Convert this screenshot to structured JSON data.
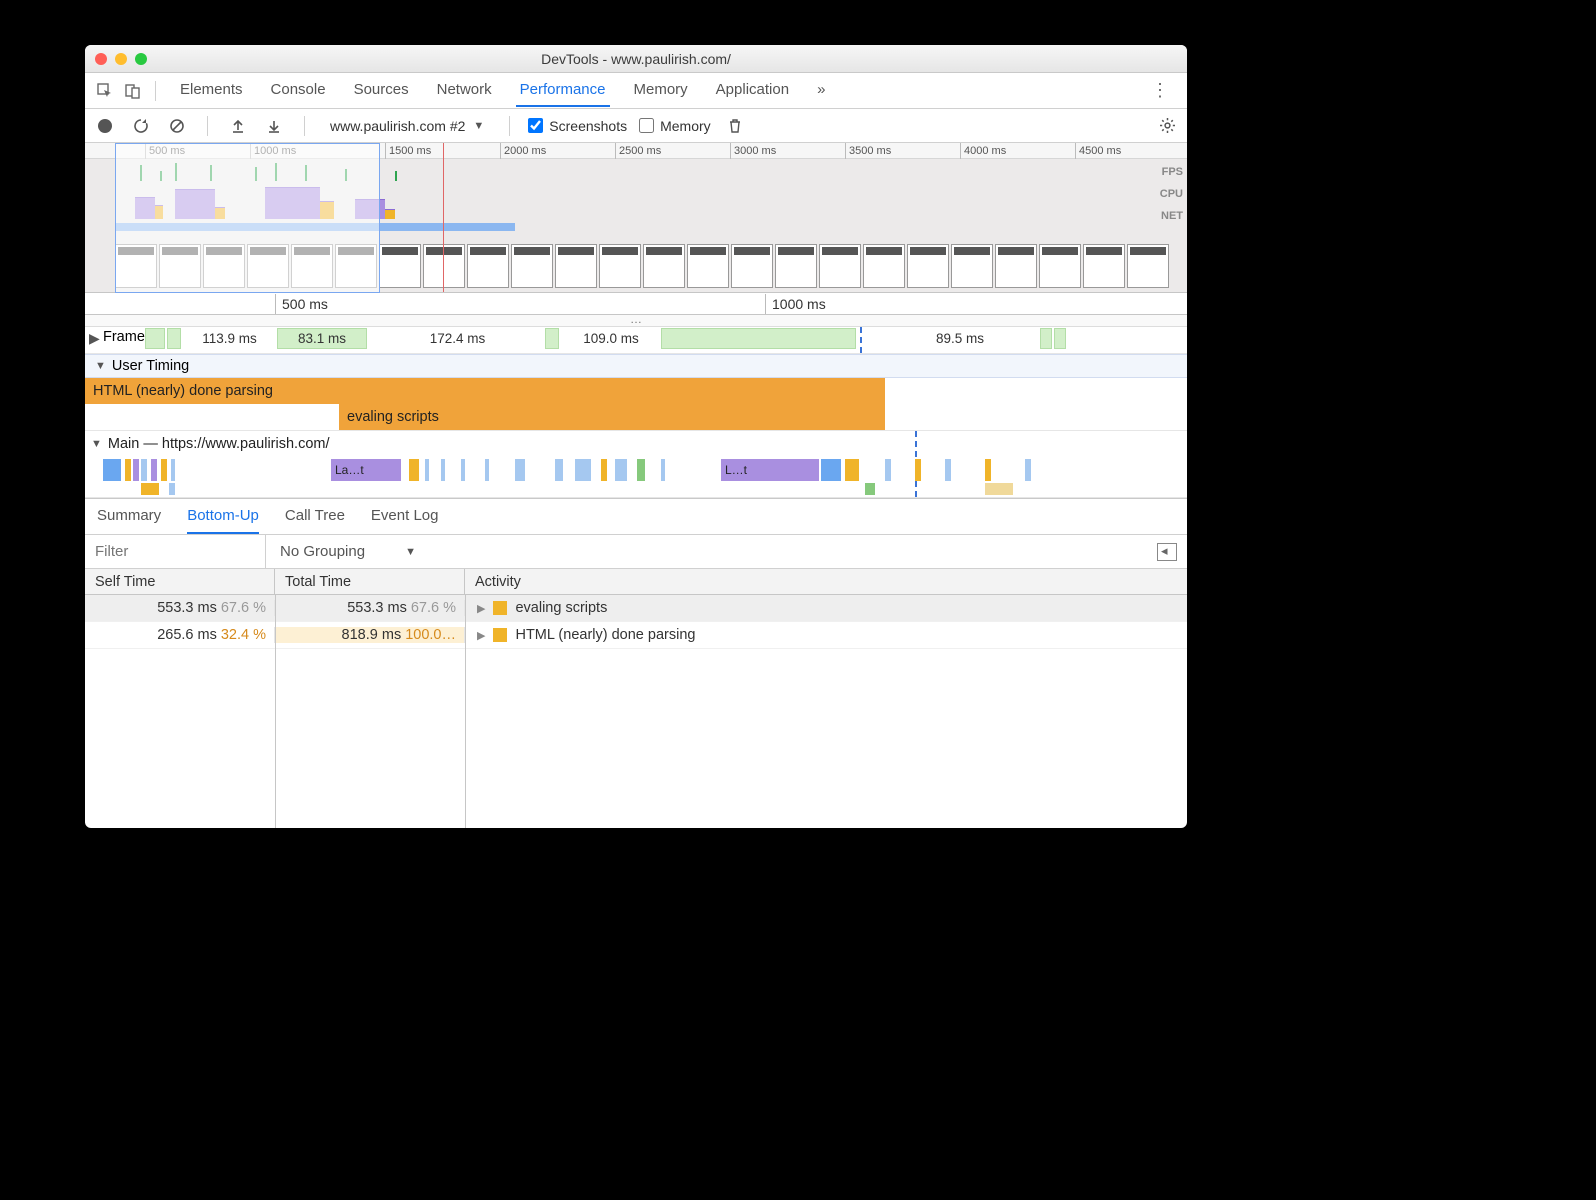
{
  "window_title": "DevTools - www.paulirish.com/",
  "tabs": {
    "items": [
      "Elements",
      "Console",
      "Sources",
      "Network",
      "Performance",
      "Memory",
      "Application"
    ],
    "more_glyph": "»",
    "active_index": 4
  },
  "toolbar": {
    "recording_select": "www.paulirish.com #2",
    "screenshots_label": "Screenshots",
    "screenshots_checked": true,
    "memory_label": "Memory",
    "memory_checked": false
  },
  "overview": {
    "ticks": [
      "500 ms",
      "1000 ms",
      "1500 ms",
      "2000 ms",
      "2500 ms",
      "3000 ms",
      "3500 ms",
      "4000 ms",
      "4500 ms"
    ],
    "lane_labels": [
      "FPS",
      "CPU",
      "NET"
    ]
  },
  "detail_ruler": {
    "ticks": [
      "500 ms",
      "1000 ms"
    ]
  },
  "frames": {
    "label": "Frames",
    "cells": [
      "113.9 ms",
      "83.1 ms",
      "172.4 ms",
      "109.0 ms",
      "89.5 ms"
    ]
  },
  "user_timing": {
    "label": "User Timing",
    "bars": [
      "HTML (nearly) done parsing",
      "evaling scripts"
    ]
  },
  "main_track": {
    "label": "Main — https://www.paulirish.com/",
    "snippets": [
      "La…t",
      "L…t"
    ]
  },
  "details_tabs": {
    "items": [
      "Summary",
      "Bottom-Up",
      "Call Tree",
      "Event Log"
    ],
    "active_index": 1
  },
  "filter": {
    "placeholder": "Filter",
    "grouping": "No Grouping"
  },
  "table": {
    "headers": [
      "Self Time",
      "Total Time",
      "Activity"
    ],
    "rows": [
      {
        "self_ms": "553.3 ms",
        "self_pct": "67.6 %",
        "total_ms": "553.3 ms",
        "total_pct": "67.6 %",
        "activity": "evaling scripts",
        "selected": true
      },
      {
        "self_ms": "265.6 ms",
        "self_pct": "32.4 %",
        "total_ms": "818.9 ms",
        "total_pct": "100.0…",
        "activity": "HTML (nearly) done parsing",
        "selected": false
      }
    ]
  }
}
